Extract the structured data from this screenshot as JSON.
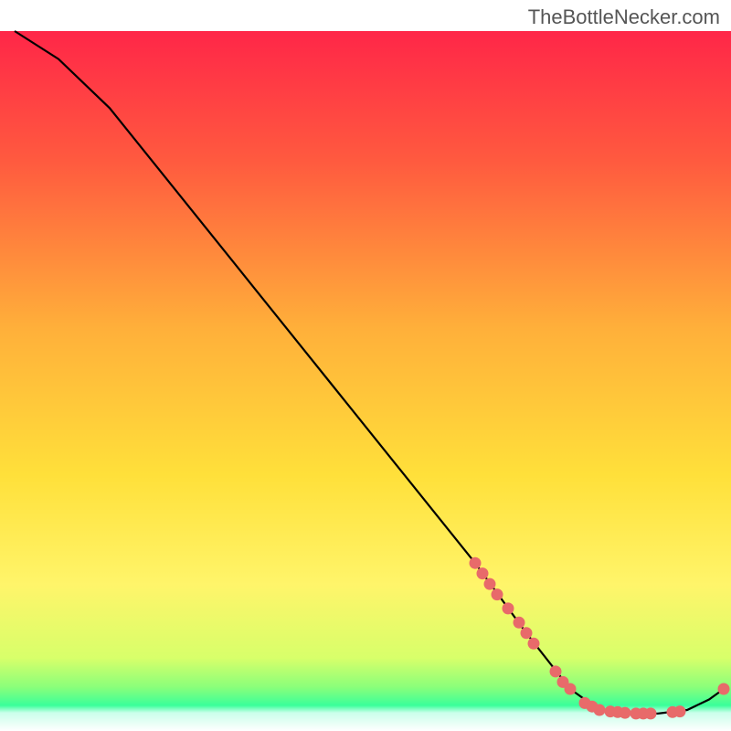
{
  "watermark": "TheBottleNecker.com",
  "chart_data": {
    "type": "line",
    "title": "",
    "xlabel": "",
    "ylabel": "",
    "xlim": [
      0,
      100
    ],
    "ylim": [
      0,
      100
    ],
    "gradient_colors": {
      "top": "#ff1a4a",
      "mid1": "#ff7a3a",
      "mid2": "#ffd93a",
      "mid3": "#fff53a",
      "bottom_band": "#4aff7a",
      "very_bottom": "#ffffff"
    },
    "line_points": [
      {
        "x": 2,
        "y": 100
      },
      {
        "x": 8,
        "y": 96
      },
      {
        "x": 15,
        "y": 89
      },
      {
        "x": 25,
        "y": 76
      },
      {
        "x": 35,
        "y": 63
      },
      {
        "x": 45,
        "y": 50
      },
      {
        "x": 55,
        "y": 37
      },
      {
        "x": 65,
        "y": 24
      },
      {
        "x": 72,
        "y": 14
      },
      {
        "x": 78,
        "y": 6
      },
      {
        "x": 82,
        "y": 3
      },
      {
        "x": 86,
        "y": 2.5
      },
      {
        "x": 90,
        "y": 2.5
      },
      {
        "x": 94,
        "y": 3
      },
      {
        "x": 97,
        "y": 4.5
      },
      {
        "x": 99,
        "y": 6
      }
    ],
    "dot_points": [
      {
        "x": 65,
        "y": 24
      },
      {
        "x": 66,
        "y": 22.5
      },
      {
        "x": 67,
        "y": 21
      },
      {
        "x": 68,
        "y": 19.5
      },
      {
        "x": 69.5,
        "y": 17.5
      },
      {
        "x": 71,
        "y": 15.5
      },
      {
        "x": 72,
        "y": 14
      },
      {
        "x": 73,
        "y": 12.5
      },
      {
        "x": 76,
        "y": 8.5
      },
      {
        "x": 77,
        "y": 7
      },
      {
        "x": 78,
        "y": 6
      },
      {
        "x": 80,
        "y": 4
      },
      {
        "x": 81,
        "y": 3.5
      },
      {
        "x": 82,
        "y": 3
      },
      {
        "x": 83.5,
        "y": 2.8
      },
      {
        "x": 84.5,
        "y": 2.7
      },
      {
        "x": 85.5,
        "y": 2.6
      },
      {
        "x": 87,
        "y": 2.5
      },
      {
        "x": 88,
        "y": 2.5
      },
      {
        "x": 89,
        "y": 2.5
      },
      {
        "x": 92,
        "y": 2.7
      },
      {
        "x": 93,
        "y": 2.8
      },
      {
        "x": 99,
        "y": 6
      }
    ],
    "dot_color": "#e86a6a",
    "line_color": "#000000"
  }
}
